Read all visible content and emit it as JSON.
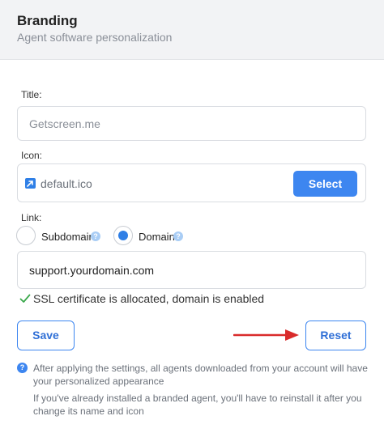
{
  "header": {
    "title": "Branding",
    "subtitle": "Agent software personalization"
  },
  "title_field": {
    "label": "Title:",
    "value": "Getscreen.me"
  },
  "icon_field": {
    "label": "Icon:",
    "filename": "default.ico",
    "select_label": "Select"
  },
  "link": {
    "label": "Link:",
    "options": [
      {
        "label": "Subdomain",
        "selected": false,
        "help": "?"
      },
      {
        "label": "Domain",
        "selected": true,
        "help": "?"
      }
    ],
    "value": "support.yourdomain.com",
    "ssl_status": "SSL certificate is allocated, domain is enabled"
  },
  "actions": {
    "save_label": "Save",
    "reset_label": "Reset"
  },
  "info": {
    "icon": "?",
    "lines": [
      "After applying the settings, all agents downloaded from your account will have",
      "your personalized appearance",
      "If you've already installed a branded agent, you'll have to reinstall it after you",
      "change its name and icon"
    ]
  },
  "colors": {
    "accent": "#3d86f0",
    "header_bg": "#f2f3f5",
    "success": "#3aa84b",
    "annotation_arrow": "#d92b2b"
  }
}
